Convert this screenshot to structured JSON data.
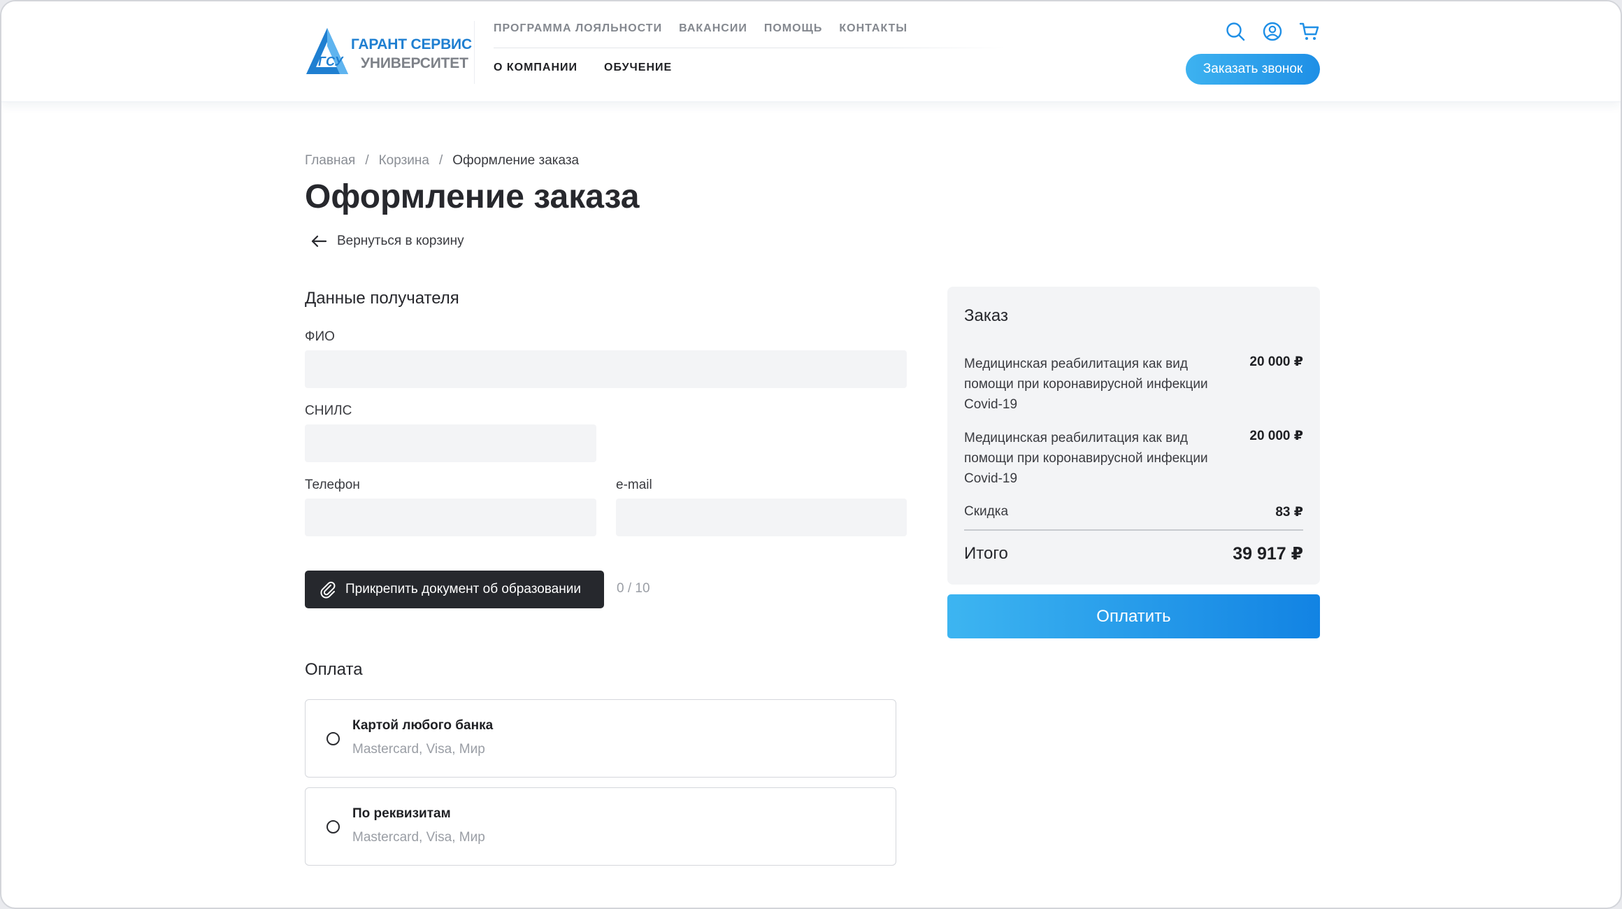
{
  "header": {
    "logo_line1": "ГАРАНТ СЕРВИС",
    "logo_line2": "УНИВЕРСИТЕТ",
    "logo_abbr": "ГСУ",
    "nav_top": [
      "ПРОГРАММА ЛОЯЛЬНОСТИ",
      "ВАКАНСИИ",
      "ПОМОЩЬ",
      "КОНТАКТЫ"
    ],
    "nav_bottom": [
      "О КОМПАНИИ",
      "ОБУЧЕНИЕ"
    ],
    "callback_label": "Заказать звонок",
    "icons": [
      "search-icon",
      "user-icon",
      "cart-icon"
    ],
    "accent_color": "#1f8fe6"
  },
  "breadcrumb": {
    "home": "Главная",
    "cart": "Корзина",
    "current": "Оформление заказа",
    "separator": "/"
  },
  "page_title": "Оформление заказа",
  "back_link": "Вернуться в корзину",
  "recipient": {
    "heading": "Данные получателя",
    "fio_label": "ФИО",
    "fio_value": "",
    "snils_label": "СНИЛС",
    "snils_value": "",
    "phone_label": "Телефон",
    "phone_value": "",
    "email_label": "e-mail",
    "email_value": "",
    "attach_label": "Прикрепить документ об образовании",
    "attach_count": "0 / 10"
  },
  "payment": {
    "heading": "Оплата",
    "options": [
      {
        "title": "Картой любого банка",
        "subtitle": "Mastercard, Visa, Мир"
      },
      {
        "title": "По реквизитам",
        "subtitle": "Mastercard, Visa, Мир"
      }
    ]
  },
  "order": {
    "heading": "Заказ",
    "items": [
      {
        "name": "Медицинская реабилитация как вид помощи при коронавирусной инфекции Covid-19",
        "price": "20 000 ₽"
      },
      {
        "name": "Медицинская реабилитация как вид помощи при коронавирусной инфекции Covid-19",
        "price": "20 000 ₽"
      }
    ],
    "discount_label": "Скидка",
    "discount_value": "83 ₽",
    "total_label": "Итого",
    "total_value": "39 917 ₽",
    "pay_button": "Оплатить"
  }
}
